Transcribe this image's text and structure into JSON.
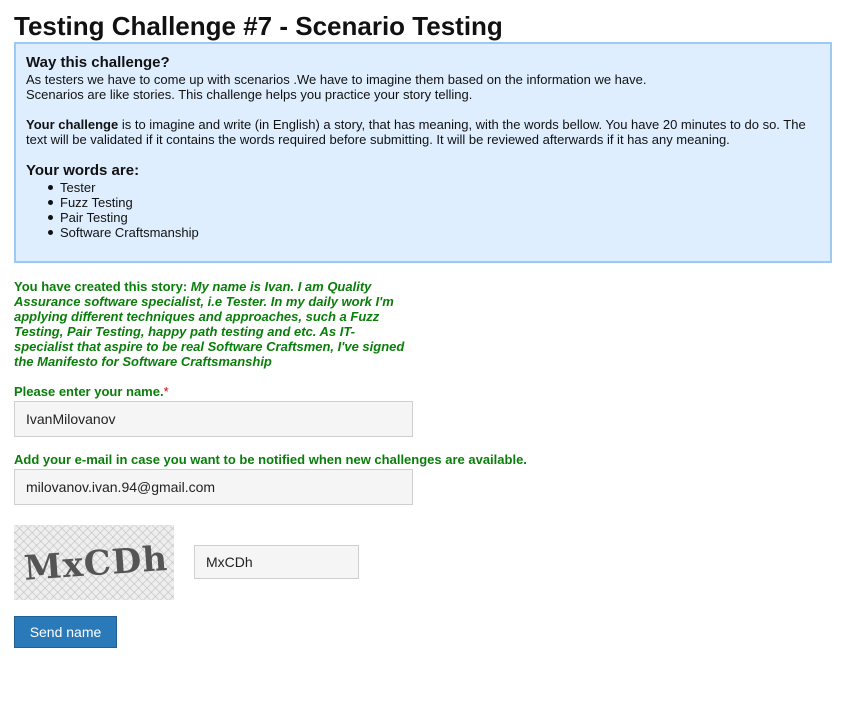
{
  "page": {
    "title": "Testing Challenge #7 - Scenario Testing"
  },
  "info": {
    "heading": "Way this challenge?",
    "line1": "As testers we have to come up with scenarios .We have to imagine them based on the information we have.",
    "line2": "Scenarios are like stories. This challenge helps you practice your story telling.",
    "challenge_bold": "Your challenge",
    "challenge_text": " is to imagine and write (in English) a story, that has meaning, with the words bellow. You have 20 minutes to do so. The text will be validated if it contains the words required before submitting. It will be reviewed afterwards if it has any meaning.",
    "words_heading": "Your words are:",
    "words": [
      "Tester",
      "Fuzz Testing",
      "Pair Testing",
      "Software Craftsmanship"
    ]
  },
  "story": {
    "prefix": "You have created this story: ",
    "text": "My name is Ivan. I am Quality Assurance software specialist, i.e Tester. In my daily work I'm applying different techniques and approaches, such a Fuzz Testing, Pair Testing, happy path testing and etc. As IT-specialist that aspire to be real Software Craftsmen, I've signed the Manifesto for Software Craftsmanship"
  },
  "form": {
    "name_label": "Please enter your name.",
    "required_mark": "*",
    "name_value": "IvanMilovanov",
    "email_label": "Add your e-mail in case you want to be notified when new challenges are available.",
    "email_value": "milovanov.ivan.94@gmail.com",
    "captcha_image_text": "MxCDh",
    "captcha_value": "MxCDh",
    "submit_label": "Send name"
  },
  "colors": {
    "info_bg": "#dfeeff",
    "info_border": "#9ccaf2",
    "green_text": "#0a7e0a",
    "button_bg": "#2a7ab9"
  }
}
